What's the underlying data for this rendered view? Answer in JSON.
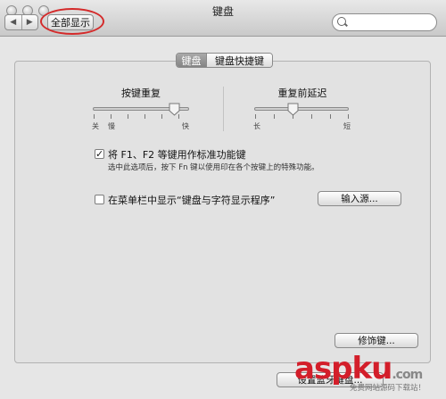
{
  "window": {
    "title": "键盘"
  },
  "toolbar": {
    "back_glyph": "◀",
    "forward_glyph": "▶",
    "show_all_label": "全部显示",
    "search_value": ""
  },
  "tabs": [
    {
      "label": "键盘",
      "selected": true
    },
    {
      "label": "键盘快捷键",
      "selected": false
    }
  ],
  "key_repeat": {
    "label": "按键重复",
    "ticks": [
      "关",
      "慢",
      "快"
    ],
    "level": 0.88
  },
  "delay_until_repeat": {
    "label": "重复前延迟",
    "ticks": [
      "长",
      "短"
    ],
    "level": 0.45
  },
  "fn_keys": {
    "label": "将 F1、F2 等键用作标准功能键",
    "checked": true,
    "note": "选中此选项后，按下 Fn 键以使用印在各个按键上的特殊功能。"
  },
  "menu_bar": {
    "label": "在菜单栏中显示“键盘与字符显示程序”",
    "checked": false
  },
  "buttons": {
    "input_sources": "输入源...",
    "modifier_keys": "修饰键...",
    "bottom_partial": "设置蓝牙键盘..."
  },
  "watermark": {
    "text": "aspku",
    "suffix": ".com",
    "sub": "免费网站源码下载站！"
  },
  "colors": {
    "annotation": "#d42a2a",
    "watermark": "#d31e2a",
    "selected_tab": "#8f8f8f"
  }
}
